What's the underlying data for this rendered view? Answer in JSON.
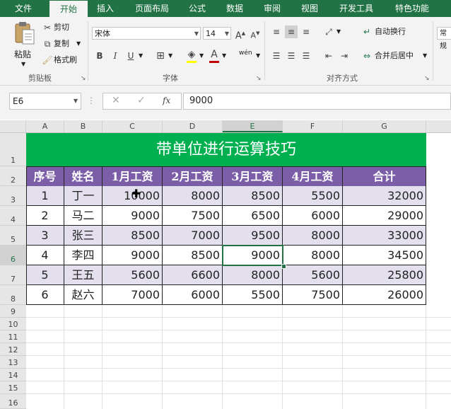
{
  "menu": {
    "tabs": [
      {
        "label": "文件",
        "active": false
      },
      {
        "label": "开始",
        "active": true
      },
      {
        "label": "插入",
        "active": false
      },
      {
        "label": "页面布局",
        "active": false
      },
      {
        "label": "公式",
        "active": false
      },
      {
        "label": "数据",
        "active": false
      },
      {
        "label": "审阅",
        "active": false
      },
      {
        "label": "视图",
        "active": false
      },
      {
        "label": "开发工具",
        "active": false
      },
      {
        "label": "特色功能",
        "active": false
      }
    ]
  },
  "ribbon": {
    "clipboard": {
      "paste": "粘贴",
      "cut": "剪切",
      "copy": "复制",
      "format_painter": "格式刷",
      "label": "剪贴板"
    },
    "font": {
      "name": "宋体",
      "size": "14",
      "label": "字体",
      "bold": "B",
      "italic": "I",
      "underline": "U",
      "grow": "A",
      "shrink": "A",
      "font_color": "A",
      "phonetic": "wén"
    },
    "alignment": {
      "wrap": "自动换行",
      "merge": "合并后居中",
      "label": "对齐方式"
    },
    "number": {
      "format": "常规"
    }
  },
  "formula_bar": {
    "name_box": "E6",
    "formula": "9000",
    "fx": "fx"
  },
  "colors": {
    "accent": "#217346",
    "title_bg": "#00b050",
    "header_bg": "#7b5ea7",
    "band": "#e4dfec"
  },
  "sheet": {
    "columns": [
      "A",
      "B",
      "C",
      "D",
      "E",
      "F",
      "G"
    ],
    "rows": [
      "1",
      "2",
      "3",
      "4",
      "5",
      "6",
      "7",
      "8",
      "9",
      "10",
      "11",
      "12",
      "13",
      "14",
      "15",
      "16"
    ],
    "title": "带单位进行运算技巧",
    "headers": [
      "序号",
      "姓名",
      "1月工资",
      "2月工资",
      "3月工资",
      "4月工资",
      "合计"
    ],
    "data": [
      [
        "1",
        "丁一",
        "10000",
        "8000",
        "8500",
        "5500",
        "32000"
      ],
      [
        "2",
        "马二",
        "9000",
        "7500",
        "6500",
        "6000",
        "29000"
      ],
      [
        "3",
        "张三",
        "8500",
        "7000",
        "9500",
        "8000",
        "33000"
      ],
      [
        "4",
        "李四",
        "9000",
        "8500",
        "9000",
        "8000",
        "34500"
      ],
      [
        "5",
        "王五",
        "5600",
        "6600",
        "8000",
        "5600",
        "25800"
      ],
      [
        "6",
        "赵六",
        "7000",
        "6000",
        "5500",
        "7500",
        "26000"
      ]
    ]
  }
}
